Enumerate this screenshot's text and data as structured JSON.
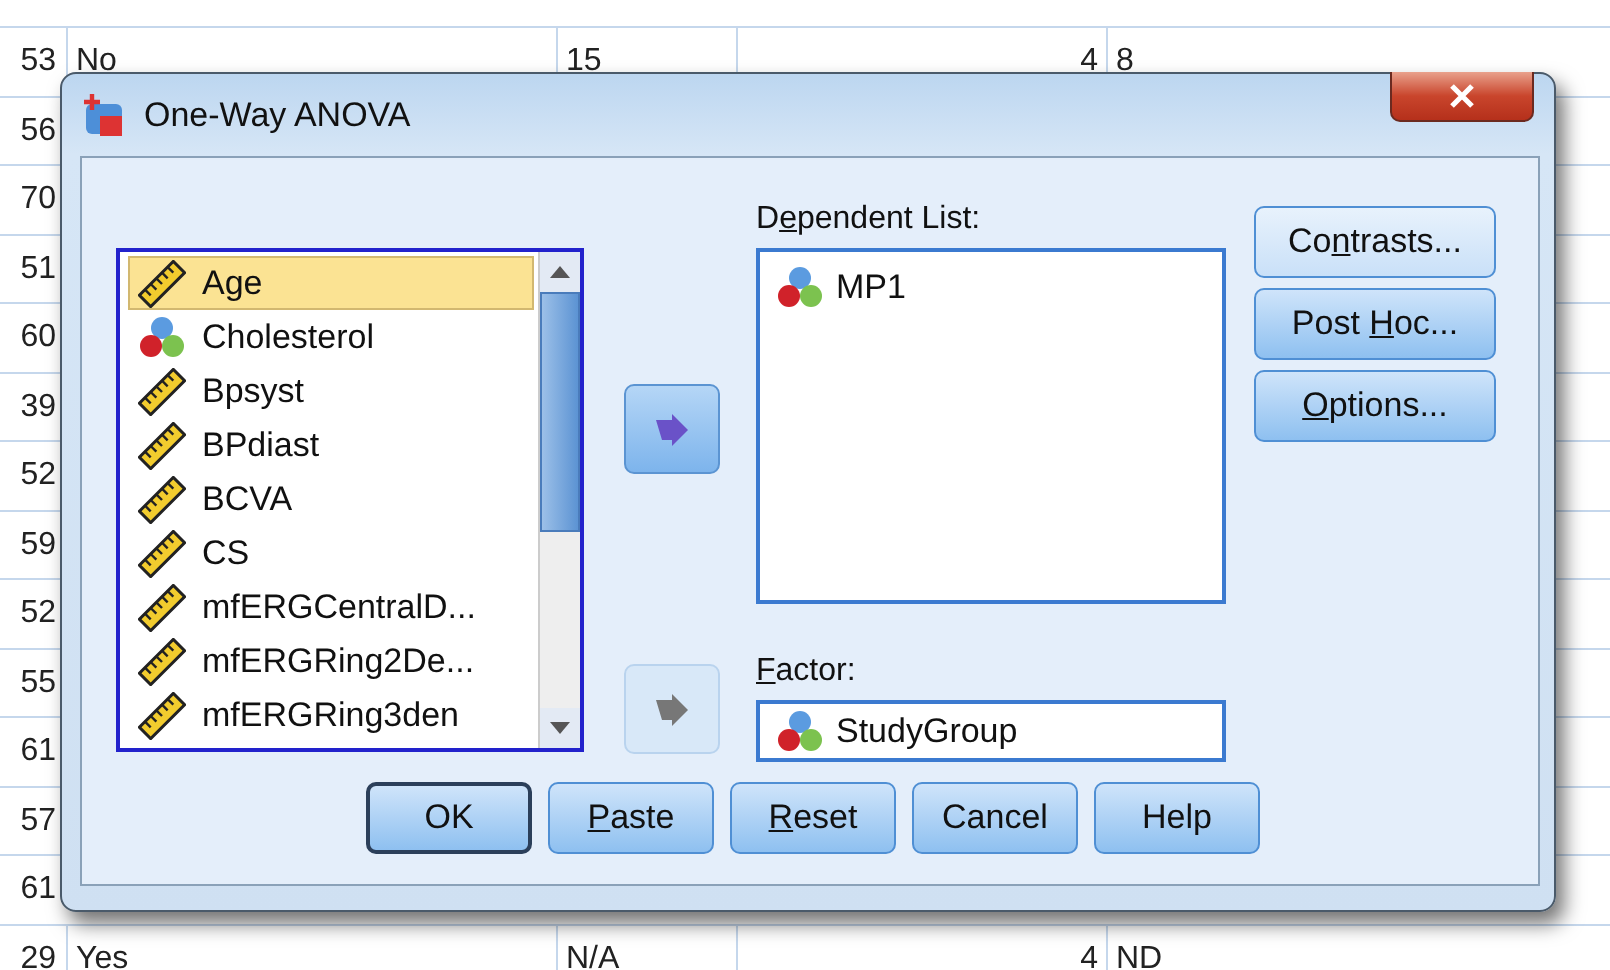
{
  "sheet": {
    "rows": [
      {
        "number": "53",
        "cells": [
          "No",
          "15",
          "4",
          "8"
        ]
      },
      {
        "number": "56",
        "cells": []
      },
      {
        "number": "70",
        "cells": []
      },
      {
        "number": "51",
        "cells": []
      },
      {
        "number": "60",
        "cells": []
      },
      {
        "number": "39",
        "cells": []
      },
      {
        "number": "52",
        "cells": []
      },
      {
        "number": "59",
        "cells": []
      },
      {
        "number": "52",
        "cells": []
      },
      {
        "number": "55",
        "cells": []
      },
      {
        "number": "61",
        "cells": []
      },
      {
        "number": "57",
        "cells": []
      },
      {
        "number": "61",
        "cells": []
      },
      {
        "number": "29",
        "cells": [
          "Yes",
          "N/A",
          "4",
          "ND"
        ]
      }
    ]
  },
  "dialog": {
    "title": "One-Way ANOVA",
    "variables": [
      {
        "name": "Age",
        "kind": "scale",
        "selected": true
      },
      {
        "name": "Cholesterol",
        "kind": "nominal",
        "selected": false
      },
      {
        "name": "Bpsyst",
        "kind": "scale",
        "selected": false
      },
      {
        "name": "BPdiast",
        "kind": "scale",
        "selected": false
      },
      {
        "name": "BCVA",
        "kind": "scale",
        "selected": false
      },
      {
        "name": "CS",
        "kind": "scale",
        "selected": false
      },
      {
        "name": "mfERGCentralD...",
        "kind": "scale",
        "selected": false
      },
      {
        "name": "mfERGRing2De...",
        "kind": "scale",
        "selected": false
      },
      {
        "name": "mfERGRing3den",
        "kind": "scale",
        "selected": false
      }
    ],
    "move_buttons": [
      {
        "disabled": false
      },
      {
        "disabled": true
      }
    ],
    "dependent": {
      "label": {
        "pre": "D",
        "key": "e",
        "post": "pendent List:"
      },
      "items": [
        {
          "name": "MP1",
          "kind": "nominal"
        }
      ]
    },
    "factor": {
      "label": {
        "key": "F",
        "post": "actor:"
      },
      "value": {
        "name": "StudyGroup",
        "kind": "nominal"
      }
    },
    "side_buttons": [
      {
        "pre": "Co",
        "key": "n",
        "post": "trasts..."
      },
      {
        "pre": "Post ",
        "key": "H",
        "post": "oc..."
      },
      {
        "key": "O",
        "post": "ptions..."
      }
    ],
    "buttons": [
      {
        "pre": "OK",
        "default": true
      },
      {
        "key": "P",
        "post": "aste",
        "default": false
      },
      {
        "key": "R",
        "post": "eset",
        "default": false
      },
      {
        "pre": "Cancel",
        "default": false
      },
      {
        "pre": "Help",
        "default": false
      }
    ]
  }
}
